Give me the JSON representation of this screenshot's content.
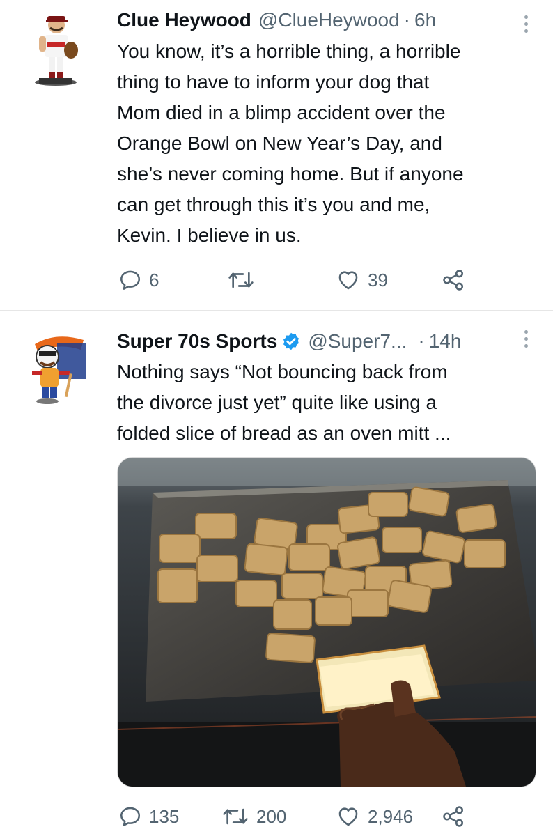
{
  "tweets": [
    {
      "name": "Clue Heywood",
      "handle": "@ClueHeywood",
      "separator": "·",
      "time": "6h",
      "text": "You know, it’s a horrible thing, a horrible\nthing to have to inform your dog that\nMom died in a blimp accident over the\nOrange Bowl on New Year’s Day, and\nshe’s never coming home. But if anyone\ncan get through this it’s you and me,\nKevin. I believe in us.",
      "verified": false,
      "replies": "6",
      "retweets": "",
      "likes": "39"
    },
    {
      "name": "Super 70s Sports",
      "handle": "@Super7...",
      "separator": "·",
      "time": "14h",
      "text": "Nothing says “Not bouncing back from\nthe divorce just yet” quite like using a\nfolded slice of bread as an oven mitt ...",
      "verified": true,
      "replies": "135",
      "retweets": "200",
      "likes": "2,946"
    }
  ],
  "colors": {
    "text": "#0f1419",
    "secondary": "#536471",
    "verified": "#1d9bf0",
    "divider": "#e6e6e6"
  },
  "icons": [
    "reply-icon",
    "retweet-icon",
    "like-icon",
    "share-icon",
    "more-icon",
    "verified-badge-icon"
  ]
}
